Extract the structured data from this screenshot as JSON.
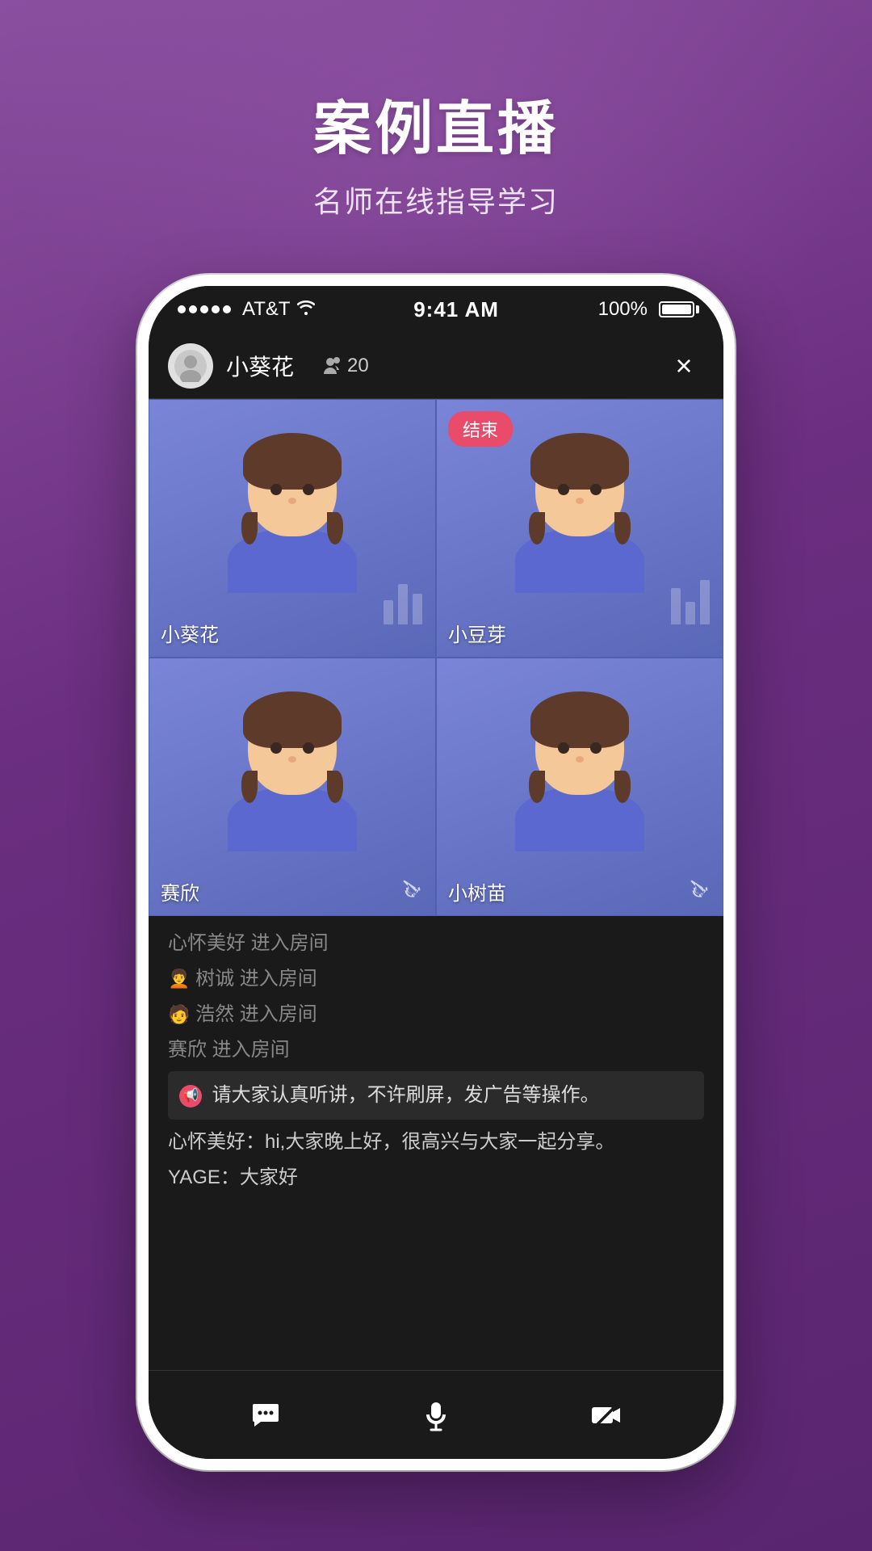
{
  "background": {
    "gradient_start": "#8B4FA0",
    "gradient_end": "#5A2570"
  },
  "header": {
    "main_title": "案例直播",
    "sub_title": "名师在线指导学习"
  },
  "status_bar": {
    "carrier": "AT&T",
    "time": "9:41 AM",
    "battery": "100%"
  },
  "app_header": {
    "host_name": "小葵花",
    "viewer_count": "20",
    "close_label": "×"
  },
  "video_grid": {
    "cells": [
      {
        "name": "小葵花",
        "has_end_badge": false,
        "has_mute": false,
        "end_label": ""
      },
      {
        "name": "小豆芽",
        "has_end_badge": true,
        "has_mute": false,
        "end_label": "结束"
      },
      {
        "name": "赛欣",
        "has_end_badge": false,
        "has_mute": true,
        "end_label": ""
      },
      {
        "name": "小树苗",
        "has_end_badge": false,
        "has_mute": true,
        "end_label": ""
      }
    ]
  },
  "chat": {
    "messages": [
      {
        "type": "system",
        "text": "心怀美好 进入房间"
      },
      {
        "type": "system",
        "emoji": "🧑‍🦱",
        "text": "树诚 进入房间"
      },
      {
        "type": "system",
        "emoji": "🧑",
        "text": "浩然 进入房间"
      },
      {
        "type": "system",
        "text": "赛欣 进入房间"
      },
      {
        "type": "notice",
        "text": "请大家认真听讲，不许刷屏，发广告等操作。"
      },
      {
        "type": "normal",
        "user": "心怀美好",
        "text": "hi,大家晚上好，很高兴与大家一起分享。"
      },
      {
        "type": "normal",
        "user": "YAGE",
        "text": "大家好"
      }
    ]
  },
  "bottom_bar": {
    "chat_icon": "💬",
    "mic_icon": "🎤",
    "camera_icon": "📷"
  }
}
